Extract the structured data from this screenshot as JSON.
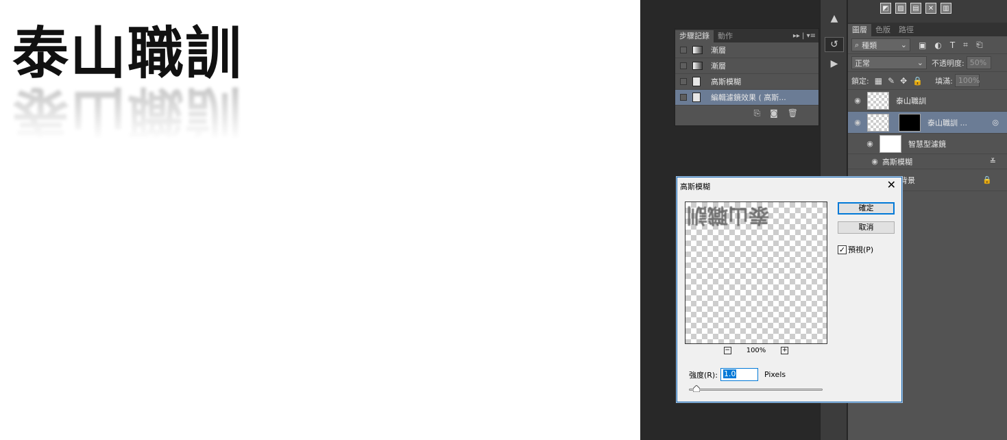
{
  "canvas": {
    "title": "泰山職訓"
  },
  "history_panel": {
    "tabs": [
      "步驟記錄",
      "動作"
    ],
    "menu": "▸▸ | ▾≡",
    "items": [
      {
        "label": "漸層",
        "icon": "gradient-icon",
        "selected": false
      },
      {
        "label": "漸層",
        "icon": "gradient-icon",
        "selected": false
      },
      {
        "label": "高斯模糊",
        "icon": "document-icon",
        "selected": false
      },
      {
        "label": "編輯濾鏡效果 ( 高斯...",
        "icon": "document-icon",
        "selected": true
      }
    ]
  },
  "layers_panel": {
    "tabs": [
      "圖層",
      "色版",
      "路徑"
    ],
    "filter_kind": "種類",
    "blend_mode": "正常",
    "opacity_label": "不透明度:",
    "opacity_value": "50%",
    "lock_label": "鎖定:",
    "fill_label": "填滿:",
    "fill_value": "100%",
    "layers": [
      {
        "name": "泰山職訓",
        "selected": false
      },
      {
        "name": "泰山職訓 ...",
        "selected": true
      },
      {
        "name": "智慧型濾鏡",
        "selected": false
      },
      {
        "name": "高斯模糊",
        "selected": false
      },
      {
        "name": "背景",
        "selected": false
      }
    ]
  },
  "dialog": {
    "title": "高斯模糊",
    "preview_text": "泰山職訓",
    "zoom": "100%",
    "ok": "確定",
    "cancel": "取消",
    "preview_label": "預視(P)",
    "preview_checked": true,
    "radius_label": "強度(R):",
    "radius_value": "1.0",
    "radius_unit": "Pixels"
  }
}
